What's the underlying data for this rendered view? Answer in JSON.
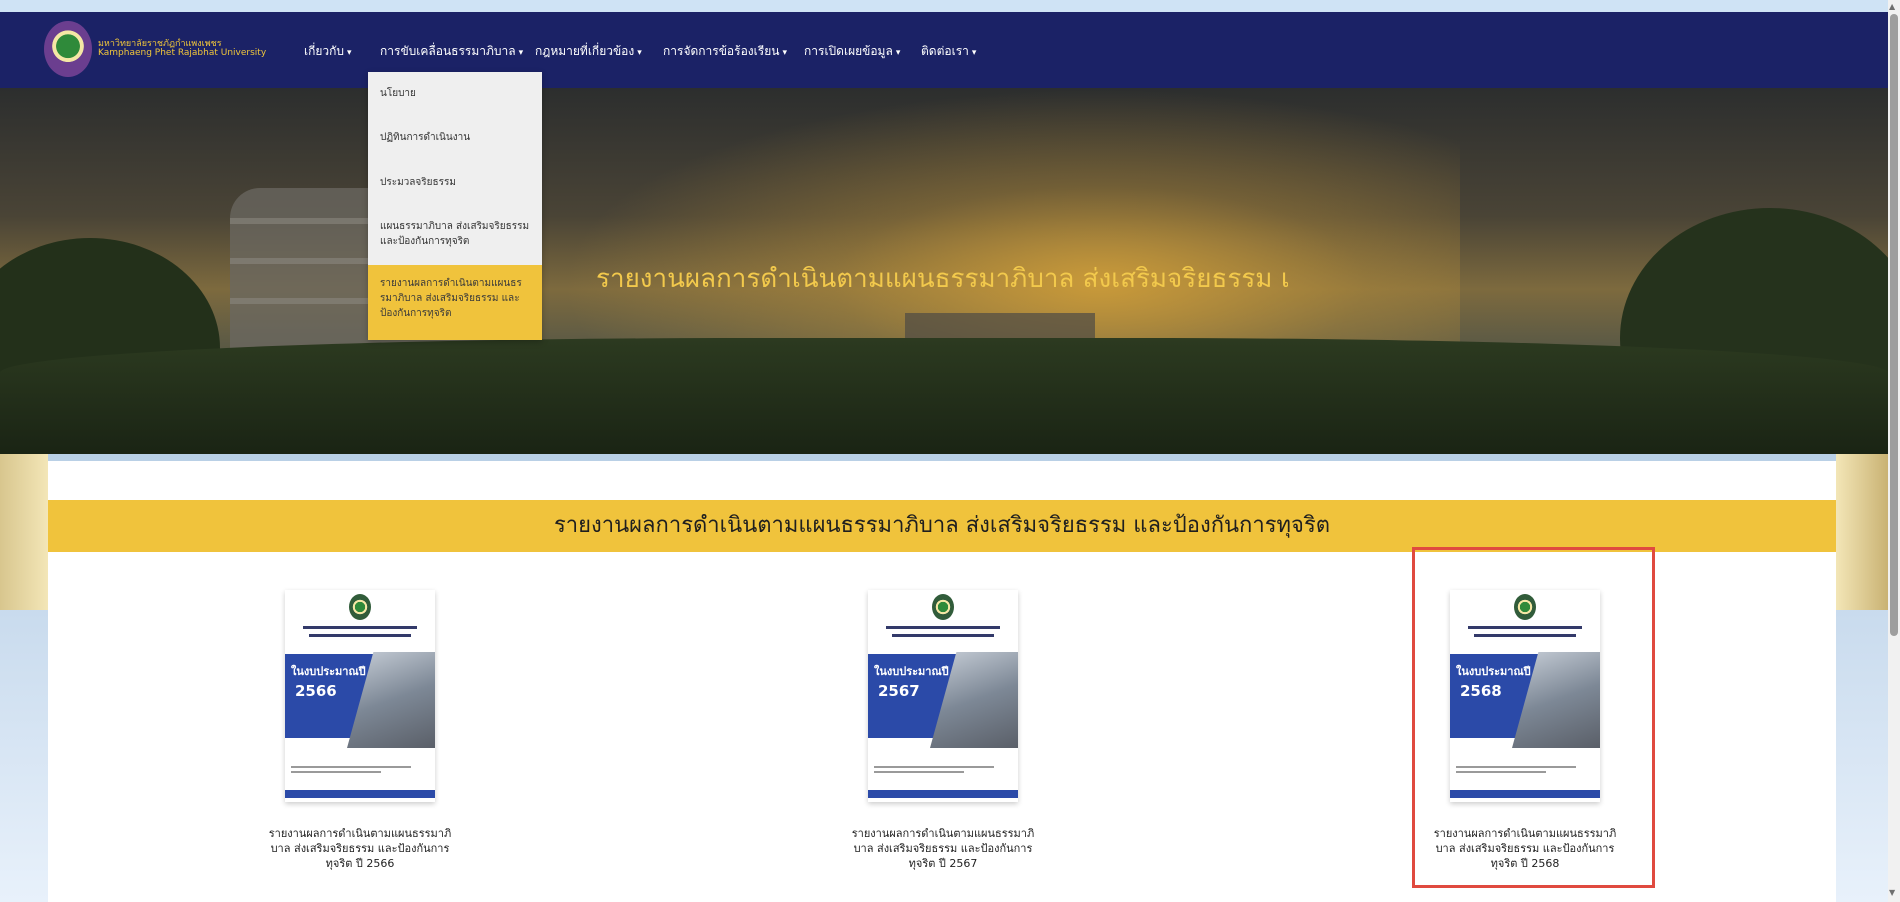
{
  "header": {
    "logo_th": "มหาวิทยาลัยราชภัฏกำแพงเพชร",
    "logo_en": "Kamphaeng Phet Rajabhat University",
    "nav": [
      {
        "label": "เกี่ยวกับ",
        "caret": "▾"
      },
      {
        "label": "การขับเคลื่อนธรรมาภิบาล",
        "caret": "▾"
      },
      {
        "label": "กฎหมายที่เกี่ยวข้อง",
        "caret": "▾"
      },
      {
        "label": "การจัดการข้อร้องเรียน",
        "caret": "▾"
      },
      {
        "label": "การเปิดเผยข้อมูล",
        "caret": "▾"
      },
      {
        "label": "ติดต่อเรา",
        "caret": "▾"
      }
    ]
  },
  "dropdown": {
    "items": [
      "นโยบาย",
      "ปฏิทินการดำเนินงาน",
      "ประมวลจริยธรรม",
      "แผนธรรมาภิบาล ส่งเสริมจริยธรรม และป้องกันการทุจริต",
      "รายงานผลการดำเนินตามแผนธรรมาภิบาล ส่งเสริมจริยธรรม และป้องกันการทุจริต"
    ],
    "active_index": 4
  },
  "hero": {
    "title": "รายงานผลการดำเนินตามแผนธรรมาภิบาล ส่งเสริมจริยธรรม และป้องกันการทุจริต"
  },
  "section": {
    "title": "รายงานผลการดำเนินตามแผนธรรมาภิบาล ส่งเสริมจริยธรรม และป้องกันการทุจริต"
  },
  "cards": [
    {
      "cover_label": "ในงบประมาณปี",
      "cover_year": "2566",
      "caption": "รายงานผลการดำเนินตามแผนธรรมาภิบาล ส่งเสริมจริยธรรม และป้องกันการทุจริต ปี 2566"
    },
    {
      "cover_label": "ในงบประมาณปี",
      "cover_year": "2567",
      "caption": "รายงานผลการดำเนินตามแผนธรรมาภิบาล ส่งเสริมจริยธรรม และป้องกันการทุจริต ปี 2567"
    },
    {
      "cover_label": "ในงบประมาณปี",
      "cover_year": "2568",
      "caption": "รายงานผลการดำเนินตามแผนธรรมาภิบาล ส่งเสริมจริยธรรม และป้องกันการทุจริต ปี 2568"
    }
  ],
  "colors": {
    "nav_bg": "#1b2266",
    "accent_yellow": "#f0c33c",
    "highlight_red": "#e04a3f",
    "cover_blue": "#2b4aa8"
  },
  "scrollbar": {
    "up_icon": "▲",
    "down_icon": "▼"
  }
}
